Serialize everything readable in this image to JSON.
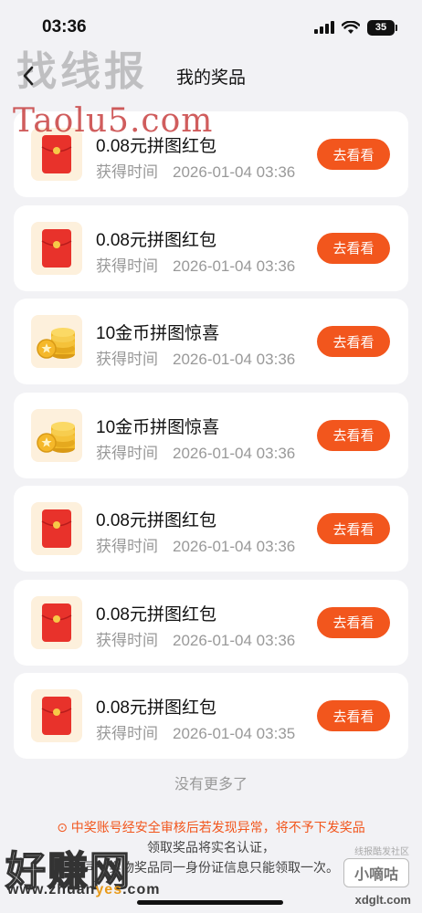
{
  "status_bar": {
    "time": "03:36",
    "battery": "35",
    "signal_icon": "cellular-signal-icon",
    "wifi_icon": "wifi-icon"
  },
  "nav": {
    "title": "我的奖品",
    "back_icon": "chevron-left-icon"
  },
  "watermarks": {
    "top": "找线报",
    "site": "Taolu5.com",
    "bottom_left": "好赚网",
    "bottom_left_url_prefix": "www.zhuan",
    "bottom_left_url_highlight": "yes",
    "bottom_left_url_suffix": ".com",
    "right_small": "线报酷发社区",
    "right_logo": "小嘀咕",
    "right_url": "xdglt.com"
  },
  "prizes": [
    {
      "title": "0.08元拼图红包",
      "time_label": "获得时间",
      "time": "2026-01-04 03:36",
      "button": "去看看",
      "icon": "red-envelope-icon"
    },
    {
      "title": "0.08元拼图红包",
      "time_label": "获得时间",
      "time": "2026-01-04 03:36",
      "button": "去看看",
      "icon": "red-envelope-icon"
    },
    {
      "title": "10金币拼图惊喜",
      "time_label": "获得时间",
      "time": "2026-01-04 03:36",
      "button": "去看看",
      "icon": "gold-coins-icon"
    },
    {
      "title": "10金币拼图惊喜",
      "time_label": "获得时间",
      "time": "2026-01-04 03:36",
      "button": "去看看",
      "icon": "gold-coins-icon"
    },
    {
      "title": "0.08元拼图红包",
      "time_label": "获得时间",
      "time": "2026-01-04 03:36",
      "button": "去看看",
      "icon": "red-envelope-icon"
    },
    {
      "title": "0.08元拼图红包",
      "time_label": "获得时间",
      "time": "2026-01-04 03:36",
      "button": "去看看",
      "icon": "red-envelope-icon"
    },
    {
      "title": "0.08元拼图红包",
      "time_label": "获得时间",
      "time": "2026-01-04 03:35",
      "button": "去看看",
      "icon": "red-envelope-icon"
    }
  ],
  "footer": {
    "no_more": "没有更多了",
    "notice_line1": "⊙ 中奖账号经安全审核后若发现异常，将不予下发奖品",
    "notice_line2": "领取奖品将实名认证，",
    "notice_line3": "同一实物奖品同一身份证信息只能领取一次。"
  },
  "colors": {
    "accent": "#f2561d",
    "background": "#f2f2f5",
    "card": "#ffffff",
    "muted_text": "#999999"
  }
}
